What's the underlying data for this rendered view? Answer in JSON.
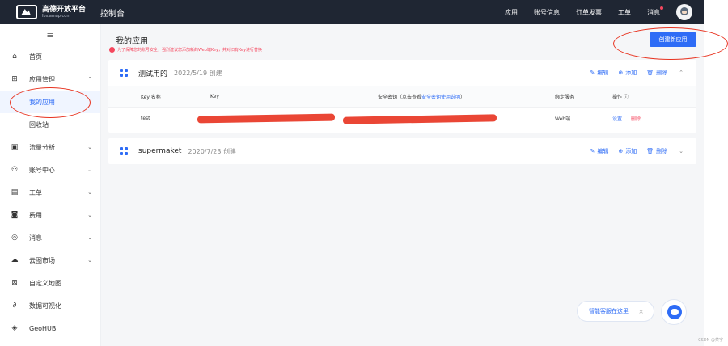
{
  "topbar": {
    "logo_title": "高德开放平台",
    "logo_sub": "lbs.amap.com",
    "console": "控制台",
    "nav": [
      "应用",
      "账号信息",
      "订单发票",
      "工单",
      "消息"
    ]
  },
  "sidebar": {
    "menu_icon": "≡",
    "items": [
      {
        "label": "首页",
        "icon": "home-icon"
      },
      {
        "label": "应用管理",
        "icon": "apps-icon"
      },
      {
        "label": "我的应用"
      },
      {
        "label": "回收站"
      },
      {
        "label": "流量分析",
        "icon": "chart-icon"
      },
      {
        "label": "账号中心",
        "icon": "user-icon"
      },
      {
        "label": "工单",
        "icon": "ticket-icon"
      },
      {
        "label": "费用",
        "icon": "fee-icon"
      },
      {
        "label": "消息",
        "icon": "message-icon"
      },
      {
        "label": "云图市场",
        "icon": "cloud-icon"
      },
      {
        "label": "自定义地图",
        "icon": "map-icon"
      },
      {
        "label": "数据可视化",
        "icon": "visual-icon"
      },
      {
        "label": "GeoHUB",
        "icon": "geohub-icon"
      }
    ]
  },
  "main": {
    "title": "我的应用",
    "tip": "为了保障您的账号安全，强烈建议您添加新的Web端Key，并对旧有Key进行替换",
    "create_button": "创建新应用"
  },
  "apps": [
    {
      "name": "测试用的",
      "date": "2022/5/19 创建",
      "actions": {
        "edit": "编辑",
        "add": "添加",
        "delete": "删除"
      },
      "table": {
        "headers": {
          "key_name": "Key 名称",
          "key": "Key",
          "secret": "安全密钥（点击查看",
          "secret_link": "安全密钥使用说明",
          "secret_close": "）",
          "service": "绑定服务",
          "op": "操作 ⓘ"
        },
        "row": {
          "key_name": "test",
          "service": "Web端",
          "settings": "设置",
          "delete": "删除"
        }
      }
    },
    {
      "name": "supermaket",
      "date": "2020/7/23 创建",
      "actions": {
        "edit": "编辑",
        "add": "添加",
        "delete": "删除"
      }
    }
  ],
  "assistant": {
    "text": "智能客服在这里",
    "close": "×"
  },
  "watermark": "CSDN @菜宇",
  "colors": {
    "accent": "#2e6cf6",
    "topbar": "#1f2633",
    "danger": "#f5475e",
    "annotation": "#e8321f"
  }
}
